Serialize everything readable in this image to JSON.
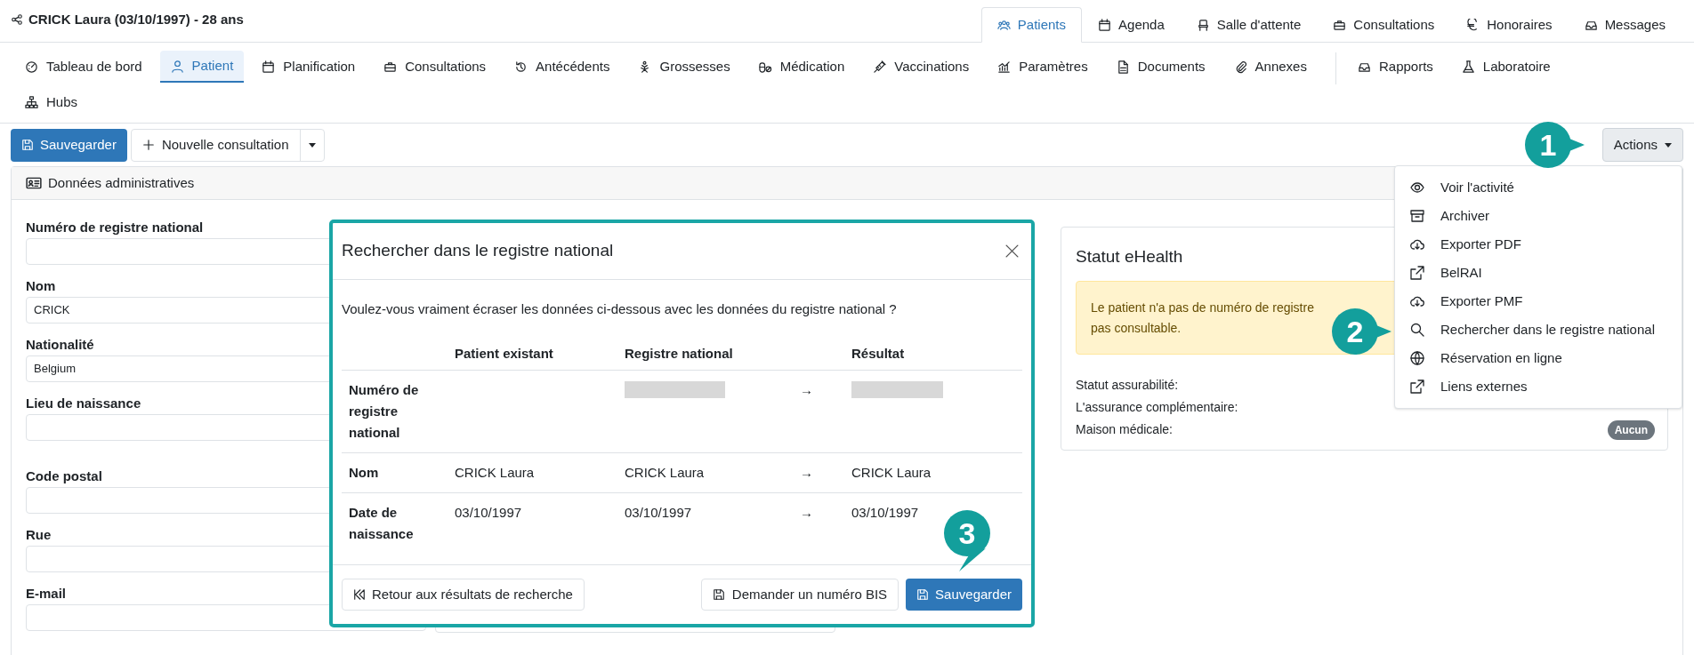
{
  "header": {
    "title": "CRICK Laura (03/10/1997) - 28 ans"
  },
  "main_tabs": [
    {
      "label": "Patients",
      "selected": true
    },
    {
      "label": "Agenda",
      "selected": false
    },
    {
      "label": "Salle d'attente",
      "selected": false
    },
    {
      "label": "Consultations",
      "selected": false
    },
    {
      "label": "Honoraires",
      "selected": false
    },
    {
      "label": "Messages",
      "selected": false
    }
  ],
  "patient_tabs": [
    {
      "label": "Tableau de bord",
      "selected": false
    },
    {
      "label": "Patient",
      "selected": true
    },
    {
      "label": "Planification",
      "selected": false
    },
    {
      "label": "Consultations",
      "selected": false
    },
    {
      "label": "Antécédents",
      "selected": false
    },
    {
      "label": "Grossesses",
      "selected": false
    },
    {
      "label": "Médication",
      "selected": false
    },
    {
      "label": "Vaccinations",
      "selected": false
    },
    {
      "label": "Paramètres",
      "selected": false
    },
    {
      "label": "Documents",
      "selected": false
    },
    {
      "label": "Annexes",
      "selected": false
    },
    {
      "label": "Rapports",
      "selected": false,
      "separator_before": true
    },
    {
      "label": "Laboratoire",
      "selected": false
    },
    {
      "label": "Hubs",
      "selected": false
    }
  ],
  "toolbar": {
    "save": "Sauvegarder",
    "new_consultation": "Nouvelle consultation",
    "actions": "Actions"
  },
  "card": {
    "title": "Données administratives",
    "fields": [
      {
        "label": "Numéro de registre national"
      },
      {
        "label": "Nom",
        "value": "CRICK"
      },
      {
        "label": "Nationalité",
        "value": "Belgium"
      },
      {
        "label": "Lieu de naissance"
      },
      {
        "label": "Code postal"
      },
      {
        "label": "Rue"
      },
      {
        "label": "E-mail"
      }
    ]
  },
  "ehealth": {
    "title": "Statut eHealth",
    "alert_lines": [
      "Le patient n'a pas de numéro de registre",
      "pas consultable."
    ],
    "rows": [
      {
        "label": "Statut assurabilité:"
      },
      {
        "label": "L'assurance complémentaire:"
      },
      {
        "label": "Maison médicale:",
        "badge": "Aucun"
      }
    ]
  },
  "actions_menu": [
    "Voir l'activité",
    "Archiver",
    "Exporter PDF",
    "BelRAI",
    "Exporter PMF",
    "Rechercher dans le registre national",
    "Réservation en ligne",
    "Liens externes"
  ],
  "modal": {
    "title": "Rechercher dans le registre national",
    "question": "Voulez-vous vraiment écraser les données ci-dessous avec les données du registre national ?",
    "columns": [
      "Patient existant",
      "Registre national",
      "Résultat"
    ],
    "rows": [
      {
        "label": "Numéro de registre national",
        "registry_redacted": true,
        "result_redacted": true,
        "arrow": "→"
      },
      {
        "label": "Nom",
        "existing": "CRICK Laura",
        "registry": "CRICK Laura",
        "result": "CRICK Laura",
        "arrow": "→"
      },
      {
        "label": "Date de naissance",
        "existing": "03/10/1997",
        "registry": "03/10/1997",
        "result": "03/10/1997",
        "arrow": "→"
      }
    ],
    "back": "Retour aux résultats de recherche",
    "bis": "Demander un numéro BIS",
    "save": "Sauvegarder"
  },
  "callouts": [
    "1",
    "2",
    "3"
  ]
}
